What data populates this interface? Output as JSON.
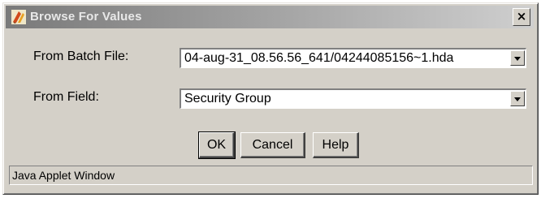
{
  "window": {
    "title": "Browse For Values",
    "close_glyph": "×",
    "icon": "java-applet-icon"
  },
  "form": {
    "batch_file_label": "From Batch File:",
    "batch_file_value": "04-aug-31_08.56.56_641/04244085156~1.hda",
    "field_label": "From Field:",
    "field_value": "Security Group"
  },
  "buttons": {
    "ok": "OK",
    "cancel": "Cancel",
    "help": "Help"
  },
  "status": {
    "text": "Java Applet Window"
  },
  "colors": {
    "dialog_bg": "#d4d0c8",
    "title_gradient_start": "#7a7a7a",
    "title_gradient_end": "#cfcfcf"
  }
}
